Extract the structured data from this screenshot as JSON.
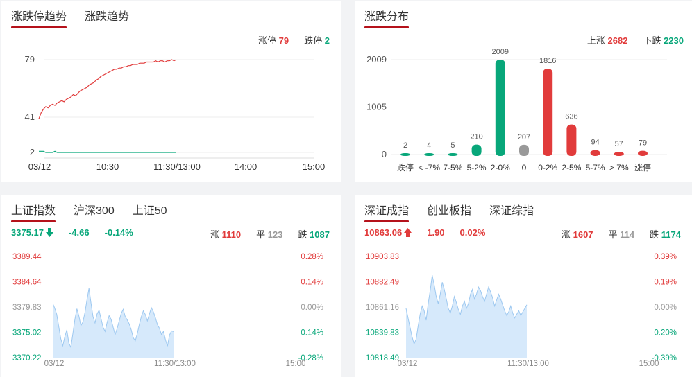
{
  "trend_panel": {
    "tabs": [
      {
        "label": "涨跌停趋势"
      },
      {
        "label": "涨跌趋势"
      }
    ],
    "limit_up_label": "涨停",
    "limit_up_value": "79",
    "limit_down_label": "跌停",
    "limit_down_value": "2"
  },
  "dist_panel": {
    "tabs": [
      {
        "label": "涨跌分布"
      }
    ],
    "up_label": "上涨",
    "up_value": "2682",
    "down_label": "下跌",
    "down_value": "2230"
  },
  "sh_panel": {
    "tabs": [
      {
        "label": "上证指数"
      },
      {
        "label": "沪深300"
      },
      {
        "label": "上证50"
      }
    ],
    "price": "3375.17",
    "change": "-4.66",
    "change_pct": "-0.14%",
    "up_label": "涨",
    "up_value": "1110",
    "flat_label": "平",
    "flat_value": "123",
    "down_label": "跌",
    "down_value": "1087"
  },
  "sz_panel": {
    "tabs": [
      {
        "label": "深证成指"
      },
      {
        "label": "创业板指"
      },
      {
        "label": "深证综指"
      }
    ],
    "price": "10863.06",
    "change": "1.90",
    "change_pct": "0.02%",
    "up_label": "涨",
    "up_value": "1607",
    "flat_label": "平",
    "flat_value": "114",
    "down_label": "跌",
    "down_value": "1174"
  },
  "colors": {
    "red": "#e13b3b",
    "green": "#08a77a",
    "gray": "#999999",
    "accent": "#b5121b",
    "area": "#d6e9fb",
    "area_line": "#9dc8f0"
  },
  "chart_data": [
    {
      "type": "line",
      "id": "limit-trend",
      "x_ticks": [
        "03/12",
        "10:30",
        "11:30/13:00",
        "14:00",
        "15:00"
      ],
      "y_ticks": [
        "79",
        "41",
        "2"
      ],
      "ylim": [
        2,
        79
      ],
      "grid": true,
      "series": [
        {
          "color": "#e13b3b",
          "values": [
            30,
            35,
            38,
            40,
            39,
            41,
            42,
            41,
            43,
            44,
            45,
            44,
            46,
            47,
            48,
            50,
            49,
            51,
            53,
            54,
            55,
            56,
            58,
            59,
            60,
            62,
            63,
            65,
            66,
            67,
            68,
            69,
            70,
            71,
            71,
            72,
            72,
            73,
            73,
            74,
            74,
            75,
            75,
            75,
            76,
            76,
            76,
            77,
            77,
            77,
            77,
            78,
            77,
            78,
            78,
            77,
            78,
            78,
            79,
            78,
            79
          ]
        },
        {
          "color": "#08a77a",
          "values": [
            3,
            3,
            3,
            2,
            2,
            2,
            2,
            3,
            2,
            2,
            2,
            2,
            2,
            2,
            2,
            2,
            2,
            2,
            2,
            2,
            2,
            2,
            2,
            2,
            2,
            2,
            2,
            2,
            2,
            2,
            2,
            2,
            2,
            2,
            2,
            2,
            2,
            2,
            2,
            2,
            2,
            2,
            2,
            2,
            2,
            2,
            2,
            2,
            2,
            2,
            2,
            2,
            2,
            2,
            2,
            2,
            2,
            2,
            2,
            2,
            2
          ]
        }
      ]
    },
    {
      "type": "bar",
      "id": "up-down-distribution",
      "categories": [
        "跌停",
        "< -7%",
        "7-5%",
        "5-2%",
        "2-0%",
        "0",
        "0-2%",
        "2-5%",
        "5-7%",
        "> 7%",
        "涨停"
      ],
      "values": [
        2,
        4,
        5,
        210,
        2009,
        207,
        1816,
        636,
        94,
        57,
        79
      ],
      "colors": [
        "#08a77a",
        "#08a77a",
        "#08a77a",
        "#08a77a",
        "#08a77a",
        "#999999",
        "#e13b3b",
        "#e13b3b",
        "#e13b3b",
        "#e13b3b",
        "#e13b3b"
      ],
      "y_ticks": [
        "2009",
        "1005",
        "0"
      ],
      "ylim": [
        0,
        2009
      ],
      "grid": true
    },
    {
      "type": "area",
      "id": "shanghai-index",
      "left_ticks": [
        "3389.44",
        "3384.64",
        "3379.83",
        "3375.02",
        "3370.22"
      ],
      "right_ticks": [
        "0.28%",
        "0.14%",
        "0.00%",
        "-0.14%",
        "-0.28%"
      ],
      "x_ticks": [
        "03/12",
        "11:30/13:00",
        "15:00"
      ],
      "ylim": [
        3370.22,
        3389.44
      ],
      "values": [
        3380.5,
        3379.6,
        3378.4,
        3376.1,
        3373.8,
        3372.5,
        3374.2,
        3375.5,
        3373.0,
        3372.2,
        3374.8,
        3377.5,
        3379.5,
        3378.1,
        3376.3,
        3377.0,
        3378.8,
        3381.2,
        3383.4,
        3380.6,
        3378.0,
        3376.8,
        3378.5,
        3379.2,
        3377.6,
        3376.0,
        3375.2,
        3376.9,
        3378.2,
        3377.5,
        3376.0,
        3374.6,
        3375.8,
        3377.2,
        3378.6,
        3379.4,
        3378.0,
        3377.4,
        3376.6,
        3375.5,
        3374.0,
        3373.4,
        3374.8,
        3376.5,
        3378.0,
        3379.1,
        3378.4,
        3377.2,
        3378.5,
        3379.7,
        3378.9,
        3377.8,
        3376.5,
        3375.8,
        3374.6,
        3375.2,
        3373.6,
        3372.4,
        3374.5,
        3375.3,
        3375.17
      ],
      "fill": "#d6e9fb",
      "line": "#9dc8f0"
    },
    {
      "type": "area",
      "id": "shenzhen-component",
      "left_ticks": [
        "10903.83",
        "10882.49",
        "10861.16",
        "10839.83",
        "10818.49"
      ],
      "right_ticks": [
        "0.39%",
        "0.19%",
        "0.00%",
        "-0.20%",
        "-0.39%"
      ],
      "x_ticks": [
        "03/12",
        "11:30/13:00",
        "15:00"
      ],
      "ylim": [
        10818.49,
        10903.83
      ],
      "values": [
        10860,
        10852,
        10844,
        10836,
        10830,
        10834,
        10845,
        10855,
        10862,
        10858,
        10850,
        10864,
        10875,
        10888,
        10880,
        10870,
        10864,
        10872,
        10882,
        10876,
        10868,
        10860,
        10856,
        10862,
        10870,
        10865,
        10859,
        10855,
        10862,
        10866,
        10860,
        10864,
        10872,
        10876,
        10868,
        10872,
        10878,
        10875,
        10870,
        10866,
        10872,
        10878,
        10874,
        10869,
        10862,
        10867,
        10872,
        10868,
        10863,
        10858,
        10854,
        10857,
        10862,
        10856,
        10852,
        10855,
        10858,
        10854,
        10857,
        10860,
        10863.06
      ],
      "fill": "#d6e9fb",
      "line": "#9dc8f0"
    }
  ]
}
